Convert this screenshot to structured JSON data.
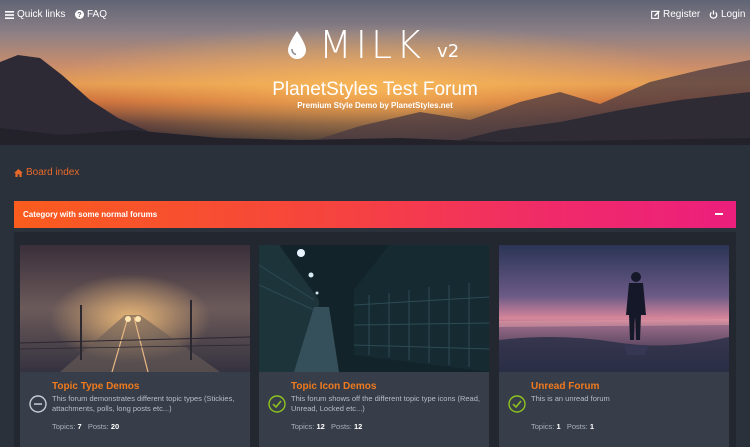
{
  "topbar": {
    "quick_links": "Quick links",
    "faq": "FAQ",
    "register": "Register",
    "login": "Login",
    "icons": [
      "menu-icon",
      "question-circle-icon",
      "edit-icon",
      "power-icon"
    ]
  },
  "logo": {
    "word": "MILK",
    "version": "v2",
    "icon": "drop-icon"
  },
  "site": {
    "title": "PlanetStyles Test Forum",
    "description": "Premium Style Demo by PlanetStyles.net"
  },
  "breadcrumb": {
    "label": "Board index",
    "icon": "home-icon"
  },
  "category": {
    "title": "Category with some normal forums",
    "collapse_icon": "minus-icon"
  },
  "forums": [
    {
      "name": "Topic Type Demos",
      "description": "This forum demonstrates different topic types (Stickies, attachments, polls, long posts etc...)",
      "topics_label": "Topics:",
      "topics": "7",
      "posts_label": "Posts:",
      "posts": "20",
      "status_icon": "no-unread-icon"
    },
    {
      "name": "Topic Icon Demos",
      "description": "This forum shows off the different topic type icons (Read, Unread, Locked etc...)",
      "topics_label": "Topics:",
      "topics": "12",
      "posts_label": "Posts:",
      "posts": "12",
      "status_icon": "unread-check-icon"
    },
    {
      "name": "Unread Forum",
      "description": "This is an unread forum",
      "topics_label": "Topics:",
      "topics": "1",
      "posts_label": "Posts:",
      "posts": "1",
      "status_icon": "unread-check-icon"
    }
  ],
  "colors": {
    "accent": "#f07a1e",
    "category_gradient_start": "#fa5d1e",
    "category_gradient_end": "#ec1f7c",
    "unread": "#8fc31f",
    "background": "#2b313a"
  }
}
